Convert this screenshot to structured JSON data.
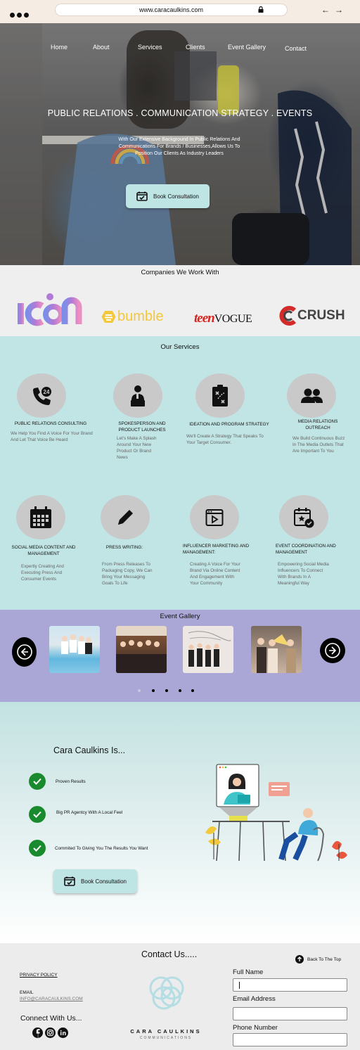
{
  "browser": {
    "url": "www.caracaulkins.com",
    "back": "←",
    "forward": "→"
  },
  "nav": {
    "home": "Home",
    "about": "About",
    "services": "Services",
    "clients": "Clients",
    "gallery": "Event Gallery",
    "contact": "Contact"
  },
  "hero": {
    "title": "PUBLIC RELATIONS . COMMUNICATION STRATEGY . EVENTS",
    "subtitle": "With Our Extensive Background In Public Relations And Communications For Brands / Businesses,Allows Us To Position Our Clients As Industry Leaders",
    "cta": "Book Consultation"
  },
  "companies": {
    "title": "Companies We Work With",
    "logos": {
      "icon": "ICON",
      "bumble": "bumble",
      "teen": "teen",
      "vogue": "VOGUE",
      "crush": "CRUSH"
    }
  },
  "services": {
    "title": "Our Services",
    "items": [
      {
        "title": "PUBLIC RELATIONS CONSULTING",
        "desc": "We Help You Find A Voice For Your Brand And Let That Voice Be Heard",
        "icon": "phone-24-icon"
      },
      {
        "title": "SPOKESPERSON AND PRODUCT LAUNCHES",
        "desc": "Let's Make A Splash Around Your New Product Or Brand News",
        "icon": "spokesperson-icon"
      },
      {
        "title": "IDEATION AND PROGRAM STRATEGY",
        "desc": "We'll Create A Strategy That Speaks To Your Target Consumer.",
        "icon": "strategy-board-icon"
      },
      {
        "title": "MEDIA RELATIONS OUTREACH",
        "desc": "We Build Continuous Buzz In The Media Outlets That Are Important To You",
        "icon": "people-icon"
      },
      {
        "title": "SOCIAL MEDIA CONTENT AND MANAGEMENT",
        "desc": "Expertly Creating And Executing Press And Consumer Events",
        "icon": "calendar-icon"
      },
      {
        "title": "PRESS WRITING:",
        "desc": "From Press Releases To Packaging Copy, We Can Bring Your Messaging Goals To Life",
        "icon": "pencil-icon"
      },
      {
        "title": "INFLUENCER MARKETING AND MANAGEMENT:",
        "desc": "Creating A Voice For Your Brand Via Online Content And Engagement With Your Community",
        "icon": "video-window-icon"
      },
      {
        "title": "EVENT COORDINATION AND MANAGEMENT",
        "desc": "Empowering Social Media Influencers To Connect With Brands In A Meaningful Way",
        "icon": "event-calendar-icon"
      }
    ]
  },
  "gallery": {
    "title": "Event Gallery",
    "page_count": 5,
    "active_page": 1
  },
  "cara": {
    "title": "Cara Caulkins Is...",
    "points": [
      "Proven Results",
      "Big PR Agentcy With A Local Feel",
      "Commited To Giving You The Results You Want"
    ],
    "cta": "Book Consultation"
  },
  "footer": {
    "title": "Contact Us.....",
    "back_to_top": "Back To The Top",
    "privacy": "PRIVACY POLICY",
    "email_label": "EMAIL",
    "email": "INFO@CARACAULKINS.COM",
    "connect": "Connect With Us...",
    "brand": "CARA CAULKINS",
    "brand_sub": "COMMUNICATIONS",
    "full_name": "Full Name",
    "email_address": "Email Address",
    "phone": "Phone Number"
  },
  "colors": {
    "services_bg": "#c1e4e4",
    "gallery_bg": "#aaa6d6",
    "button_bg": "#bfe4e4",
    "check_green": "#1a8a2e"
  }
}
